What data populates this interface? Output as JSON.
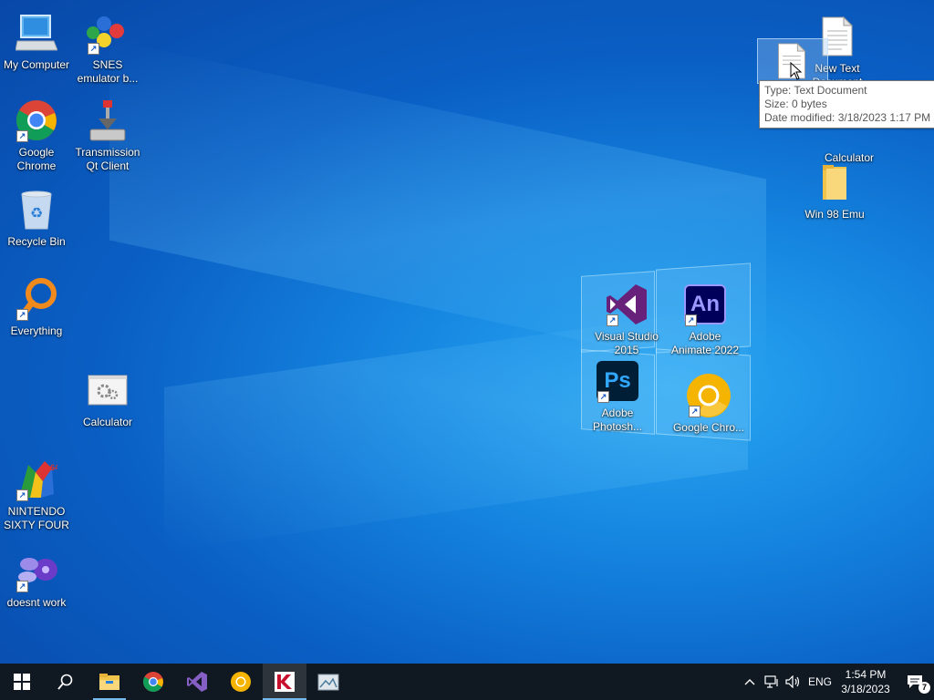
{
  "desktop": {
    "left_column": [
      {
        "label": "My Computer",
        "icon": "computer-icon"
      },
      {
        "label": "SNES emulator b...",
        "icon": "snes-emulator-icon"
      },
      {
        "label": "Google Chrome",
        "icon": "chrome-icon"
      },
      {
        "label": "Transmission Qt Client",
        "icon": "transmission-icon"
      },
      {
        "label": "Recycle Bin",
        "icon": "recycle-bin-icon"
      },
      {
        "label": "Everything",
        "icon": "everything-search-icon"
      },
      {
        "label": "Calculator",
        "icon": "calculator-icon"
      },
      {
        "label": "NINTENDO SIXTY FOUR",
        "icon": "n64-icon"
      },
      {
        "label": "doesnt work",
        "icon": "emulator-icon"
      }
    ],
    "right_column": [
      {
        "label": "New Text Document",
        "icon": "text-document-icon"
      },
      {
        "label": "Calculator",
        "icon": "calculator-icon"
      },
      {
        "label": "Win 98 Emu",
        "icon": "folder-icon"
      }
    ],
    "center_group": [
      {
        "label": "Visual Studio 2015",
        "icon": "visual-studio-icon",
        "glyph_text": ""
      },
      {
        "label": "Adobe Animate 2022",
        "icon": "adobe-animate-icon",
        "glyph_text": "An"
      },
      {
        "label": "Adobe Photosh...",
        "icon": "adobe-photoshop-icon",
        "glyph_text": "Ps"
      },
      {
        "label": "Google Chro...",
        "icon": "chrome-canary-icon",
        "glyph_text": ""
      }
    ],
    "shortcut_arrow": "↗"
  },
  "tooltip": {
    "type": "Type: Text Document",
    "size": "Size: 0 bytes",
    "modified": "Date modified: 3/18/2023 1:17 PM"
  },
  "taskbar": {
    "apps": [
      "start-icon",
      "search-icon",
      "file-explorer-icon",
      "chrome-icon",
      "visual-studio-icon",
      "chrome-canary-icon",
      "kaspersky-icon",
      "screenshot-tool-icon"
    ],
    "tray": {
      "language": "ENG",
      "time": "1:54 PM",
      "date": "3/18/2023",
      "notification_count": "7"
    }
  },
  "colors": {
    "taskbar_bg": "#101822",
    "accent": "#76b9ed",
    "desktop_blue": "#0a5fc4"
  }
}
